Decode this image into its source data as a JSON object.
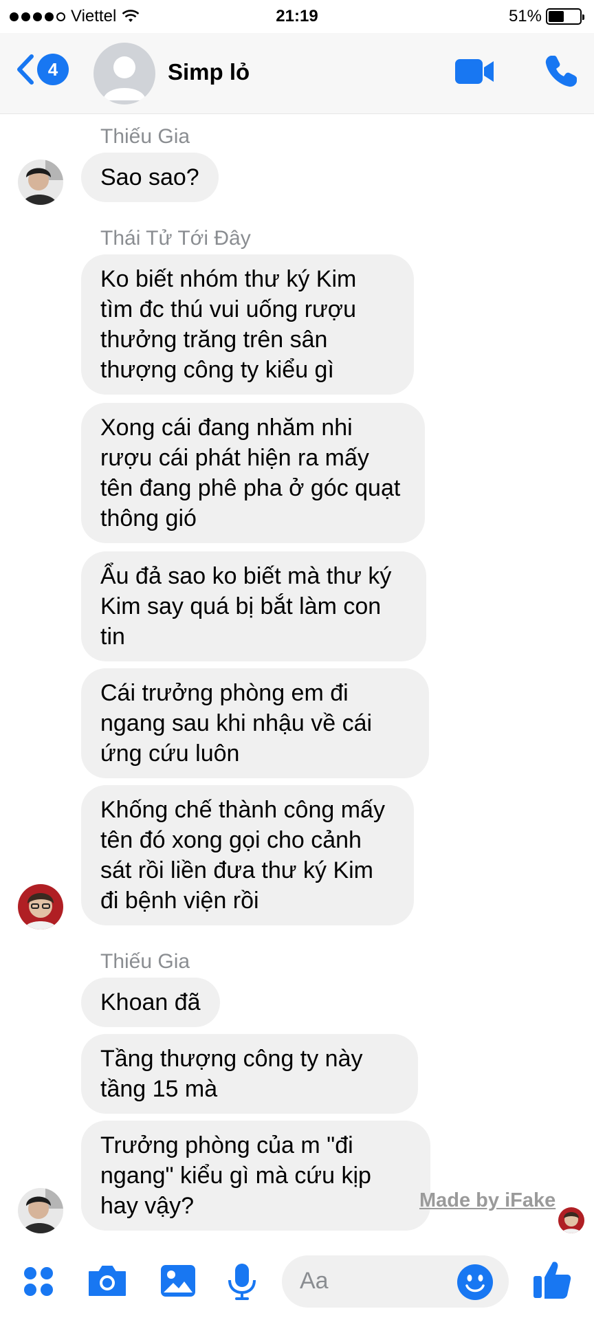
{
  "status_bar": {
    "carrier": "Viettel",
    "time": "21:19",
    "battery": "51%",
    "battery_level": 0.51
  },
  "header": {
    "back_count": "4",
    "contact_name": "Simp lỏ"
  },
  "messages": {
    "s1": "Thiếu Gia",
    "b1": "Sao sao?",
    "s2": "Thái Tử Tới Đây",
    "b2": "Ko biết nhóm thư ký Kim tìm đc thú vui uống rượu thưởng trăng trên sân thượng công ty kiểu gì",
    "b3": "Xong cái đang nhăm nhi rượu cái phát hiện ra mấy tên đang phê pha ở góc quạt thông gió",
    "b4": "Ẩu đả sao ko biết mà thư ký Kim say quá bị bắt làm con tin",
    "b5": "Cái trưởng phòng em đi ngang sau khi nhậu về cái ứng cứu luôn",
    "b6": "Khống chế thành công mấy tên đó xong gọi cho cảnh sát rồi liền đưa thư ký Kim đi bệnh viện rồi",
    "s3": "Thiếu Gia",
    "b7": "Khoan đã",
    "b8": "Tầng thượng công ty này tầng 15 mà",
    "b9": "Trưởng phòng của m \"đi ngang\" kiểu gì mà cứu kịp hay vậy?"
  },
  "watermark": "Made by iFake",
  "composer": {
    "placeholder": "Aa"
  },
  "colors": {
    "accent": "#1877f2",
    "bubble": "#f0f0f0",
    "sender": "#8a8d91"
  }
}
